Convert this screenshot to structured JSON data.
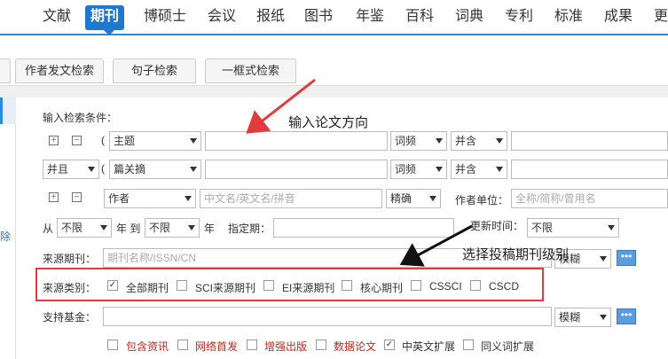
{
  "nav": {
    "items": [
      "文献",
      "期刊",
      "博硕士",
      "会议",
      "报纸",
      "图书",
      "年鉴",
      "百科",
      "词典",
      "专利",
      "标准",
      "成果",
      "更"
    ],
    "active": "期刊"
  },
  "subtabs": [
    "作者发文检索",
    "句子检索",
    "一框式检索"
  ],
  "left_delete": "除",
  "form": {
    "section_title": "输入检索条件：",
    "paren": "(",
    "row1": {
      "field": "主题",
      "freq": "词频",
      "combine": "并含"
    },
    "row2": {
      "logic": "并且",
      "field": "篇关摘",
      "freq": "词频",
      "combine": "并含"
    },
    "row3": {
      "field": "作者",
      "name_placeholder": "中文名/英文名/拼音",
      "match": "精确",
      "unit_label": "作者单位：",
      "unit_placeholder": "全称/简称/曾用名"
    },
    "row4": {
      "from_label": "从",
      "from_value": "不限",
      "year_to": "年 到",
      "to_value": "不限",
      "year": "年",
      "date_label": "指定期：",
      "update_label": "更新时间：",
      "update_value": "不限"
    },
    "source": {
      "label": "来源期刊：",
      "placeholder": "期刊名称/ISSN/CN",
      "mode": "模糊"
    },
    "category": {
      "label": "来源类别：",
      "options": [
        {
          "label": "全部期刊",
          "checked": true
        },
        {
          "label": "SCI来源期刊",
          "checked": false
        },
        {
          "label": "EI来源期刊",
          "checked": false
        },
        {
          "label": "核心期刊",
          "checked": false
        },
        {
          "label": "CSSCI",
          "checked": false
        },
        {
          "label": "CSCD",
          "checked": false
        }
      ]
    },
    "fund": {
      "label": "支持基金：",
      "mode": "模糊"
    },
    "extras": [
      {
        "label": "包含资讯",
        "checked": false,
        "color": "#c0281e"
      },
      {
        "label": "网络首发",
        "checked": false,
        "color": "#c0281e"
      },
      {
        "label": "增强出版",
        "checked": false,
        "color": "#c0281e"
      },
      {
        "label": "数据论文",
        "checked": false,
        "color": "#c0281e"
      },
      {
        "label": "中英文扩展",
        "checked": true,
        "color": "#333333"
      },
      {
        "label": "同义词扩展",
        "checked": false,
        "color": "#333333"
      }
    ],
    "plus": "+",
    "minus": "−",
    "dots": "•••",
    "check": "✓"
  },
  "annotations": {
    "topic": "输入论文方向",
    "level": "选择投稿期刊级别"
  }
}
